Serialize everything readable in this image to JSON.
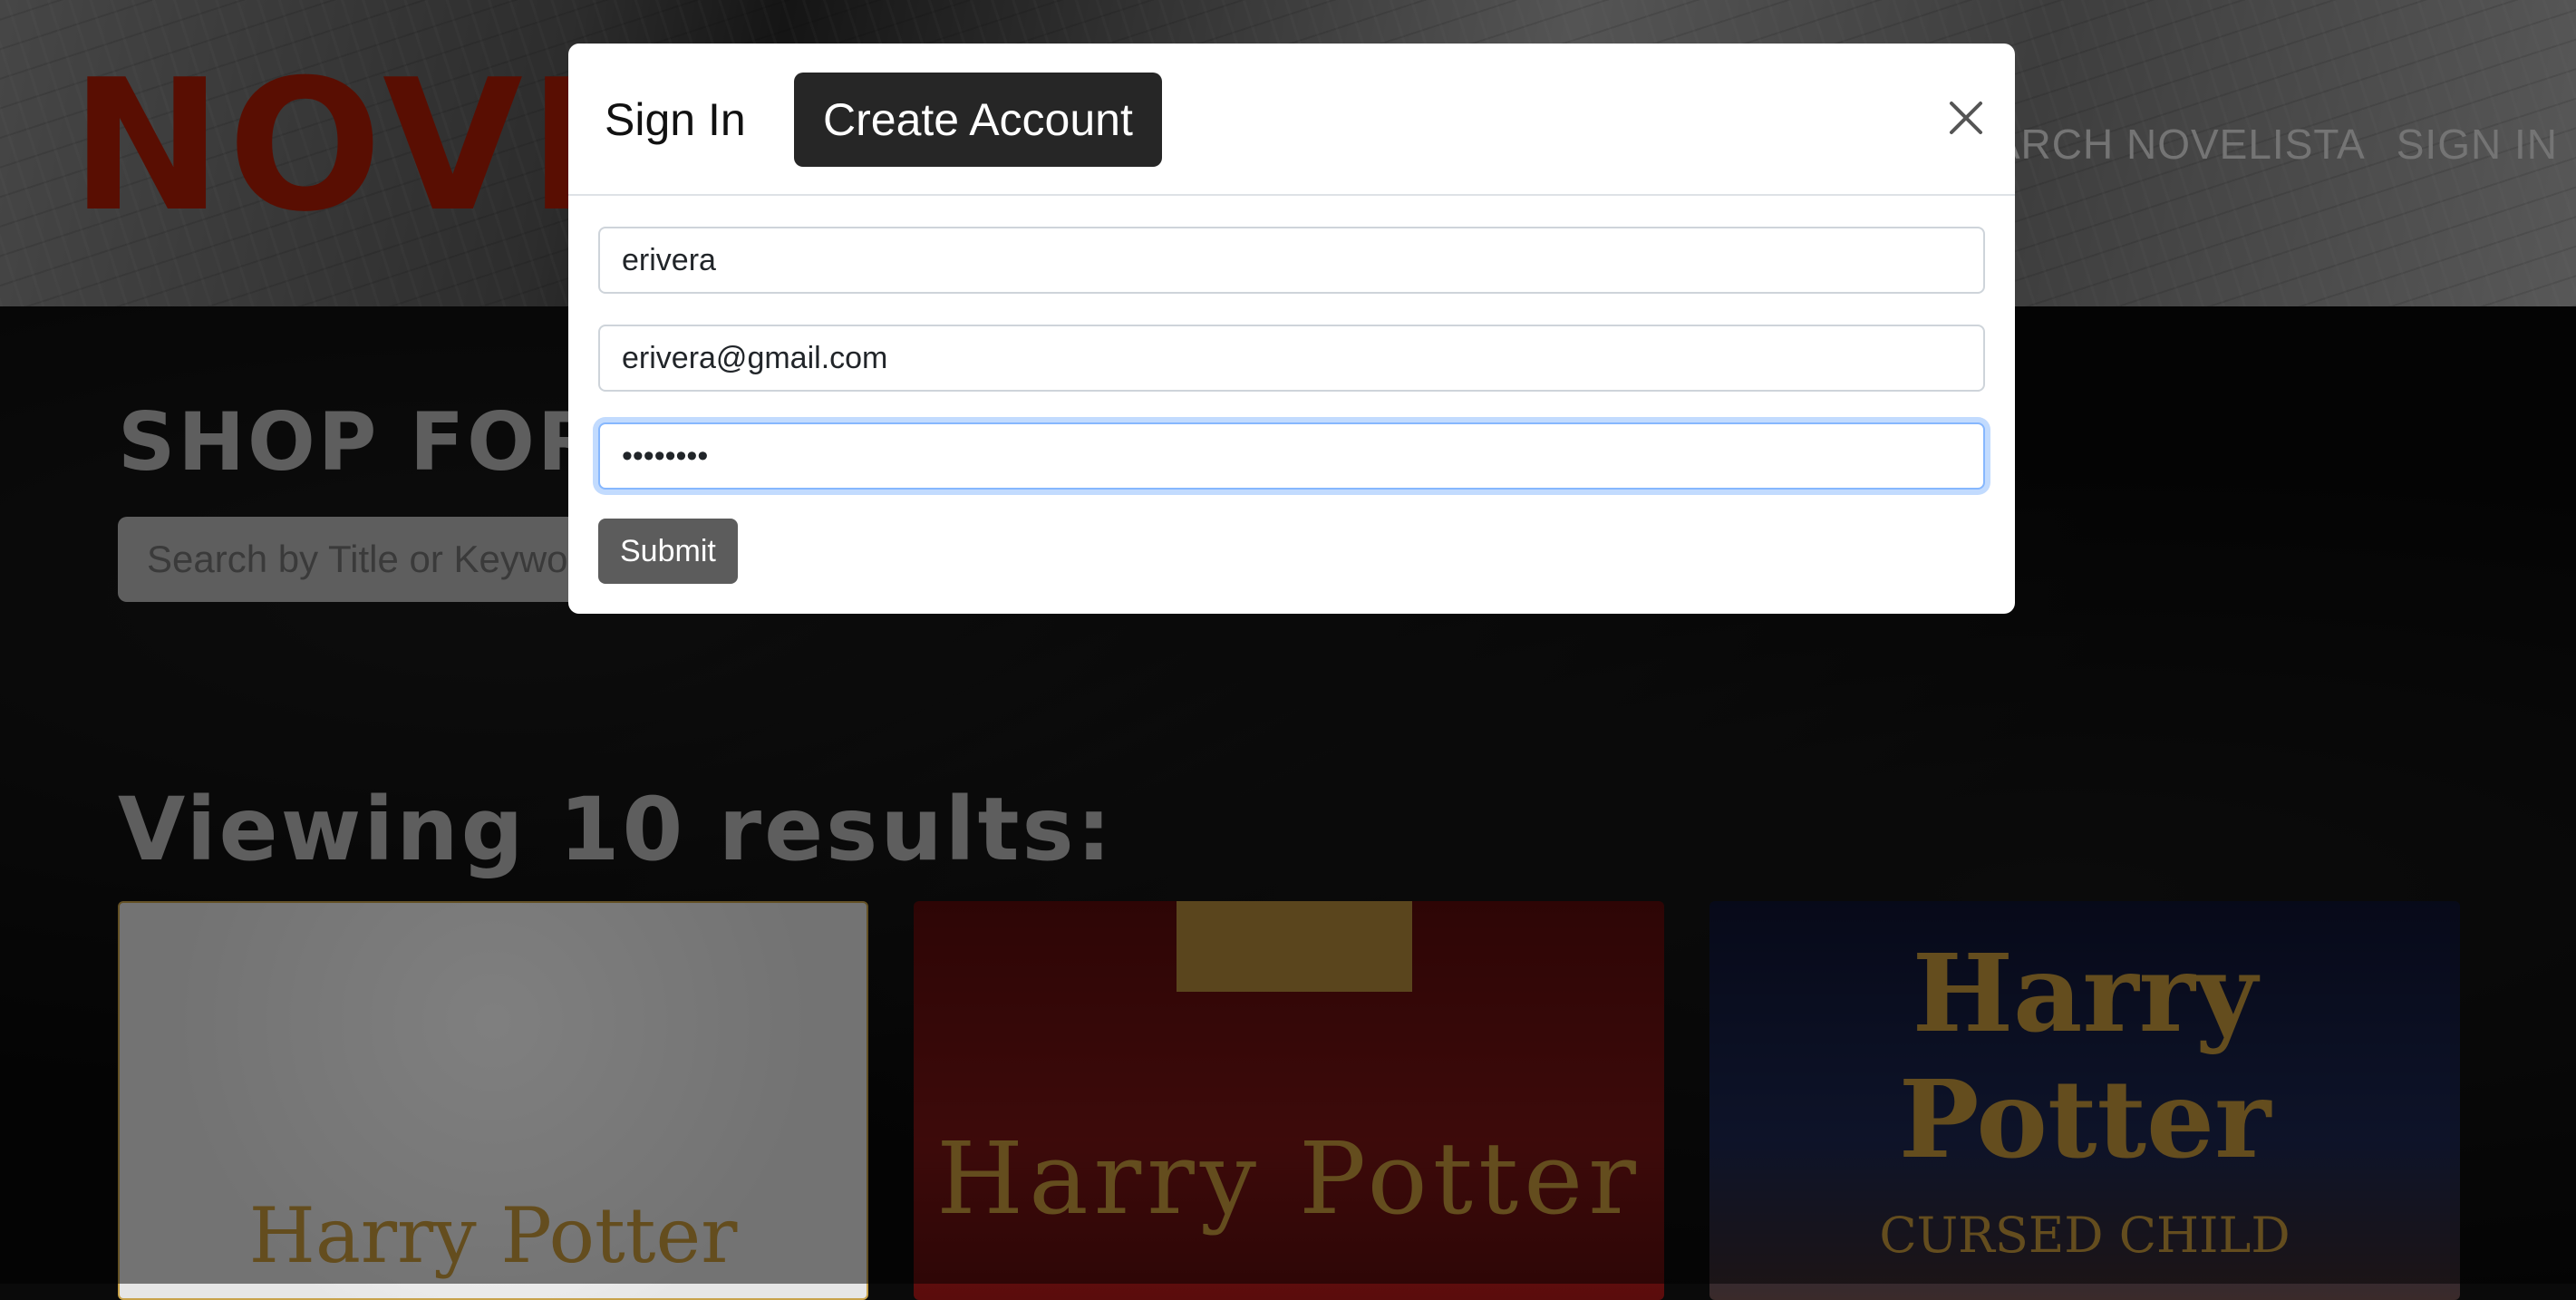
{
  "header": {
    "logo_text": "NOVELISTA",
    "nav": [
      "SEARCH NOVELISTA",
      "SIGN IN"
    ]
  },
  "main": {
    "shop_title": "SHOP FOR BOOKS",
    "search_placeholder": "Search by Title or Keyword",
    "results_title": "Viewing 10 results:",
    "cards": [
      {
        "title": "Harry Potter",
        "subtitle": ""
      },
      {
        "title": "Harry Potter",
        "subtitle": ""
      },
      {
        "title": "Harry Potter",
        "subtitle": "CURSED CHILD"
      }
    ]
  },
  "modal": {
    "tabs": {
      "sign_in": "Sign In",
      "create_account": "Create Account"
    },
    "active_tab": "create_account",
    "fields": {
      "username": "erivera",
      "email": "erivera@gmail.com",
      "password": "••••••••"
    },
    "submit_label": "Submit"
  },
  "colors": {
    "logo": "#b31d05",
    "active_tab_bg": "#262626",
    "submit_bg": "#5c5c5c",
    "focus_ring": "#86b7fe"
  }
}
